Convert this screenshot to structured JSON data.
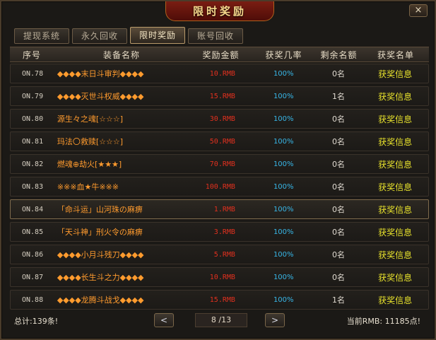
{
  "window": {
    "title": "限时奖励",
    "close_label": "×"
  },
  "tabs": [
    {
      "label": "提现系统",
      "active": false
    },
    {
      "label": "永久回收",
      "active": false
    },
    {
      "label": "限时奖励",
      "active": true
    },
    {
      "label": "账号回收",
      "active": false
    }
  ],
  "table": {
    "headers": [
      "序号",
      "装备名称",
      "奖励金额",
      "获奖几率",
      "剩余名额",
      "获奖名单"
    ],
    "rows": [
      {
        "no": "ON.78",
        "name": "◆◆◆◆末日斗审判◆◆◆◆",
        "reward": "10.RMB",
        "rate": "100%",
        "remaining": "0名",
        "winners": "获奖信息"
      },
      {
        "no": "ON.79",
        "name": "◆◆◆◆灭世斗权威◆◆◆◆",
        "reward": "15.RMB",
        "rate": "100%",
        "remaining": "1名",
        "winners": "获奖信息"
      },
      {
        "no": "ON.80",
        "name": "源生々之魂[☆☆☆]",
        "reward": "30.RMB",
        "rate": "100%",
        "remaining": "0名",
        "winners": "获奖信息"
      },
      {
        "no": "ON.81",
        "name": "玛法〇救赎[☆☆☆]",
        "reward": "50.RMB",
        "rate": "100%",
        "remaining": "0名",
        "winners": "获奖信息"
      },
      {
        "no": "ON.82",
        "name": "燃魂⊕劫火[★★★]",
        "reward": "70.RMB",
        "rate": "100%",
        "remaining": "0名",
        "winners": "获奖信息"
      },
      {
        "no": "ON.83",
        "name": "※※※血★牛※※※",
        "reward": "100.RMB",
        "rate": "100%",
        "remaining": "0名",
        "winners": "获奖信息"
      },
      {
        "no": "ON.84",
        "name": "「命斗运」山河珠の麻痹",
        "reward": "1.RMB",
        "rate": "100%",
        "remaining": "0名",
        "winners": "获奖信息"
      },
      {
        "no": "ON.85",
        "name": "「天斗神」刑火令の麻痹",
        "reward": "3.RMB",
        "rate": "100%",
        "remaining": "0名",
        "winners": "获奖信息"
      },
      {
        "no": "ON.86",
        "name": "◆◆◆◆小月斗残刀◆◆◆◆",
        "reward": "5.RMB",
        "rate": "100%",
        "remaining": "0名",
        "winners": "获奖信息"
      },
      {
        "no": "ON.87",
        "name": "◆◆◆◆长生斗之力◆◆◆◆",
        "reward": "10.RMB",
        "rate": "100%",
        "remaining": "0名",
        "winners": "获奖信息"
      },
      {
        "no": "ON.88",
        "name": "◆◆◆◆龙腾斗战戈◆◆◆◆",
        "reward": "15.RMB",
        "rate": "100%",
        "remaining": "1名",
        "winners": "获奖信息"
      }
    ]
  },
  "footer": {
    "total": "总计:139条!",
    "page": "8 /13",
    "prev_label": "<",
    "next_label": ">",
    "balance": "当前RMB: 11185点!"
  },
  "colors": {
    "item_name": "#ff9b2e",
    "reward": "#e0301e",
    "rate": "#38b7e8",
    "winners_link": "#e6e02c",
    "title": "#f8d98c"
  }
}
